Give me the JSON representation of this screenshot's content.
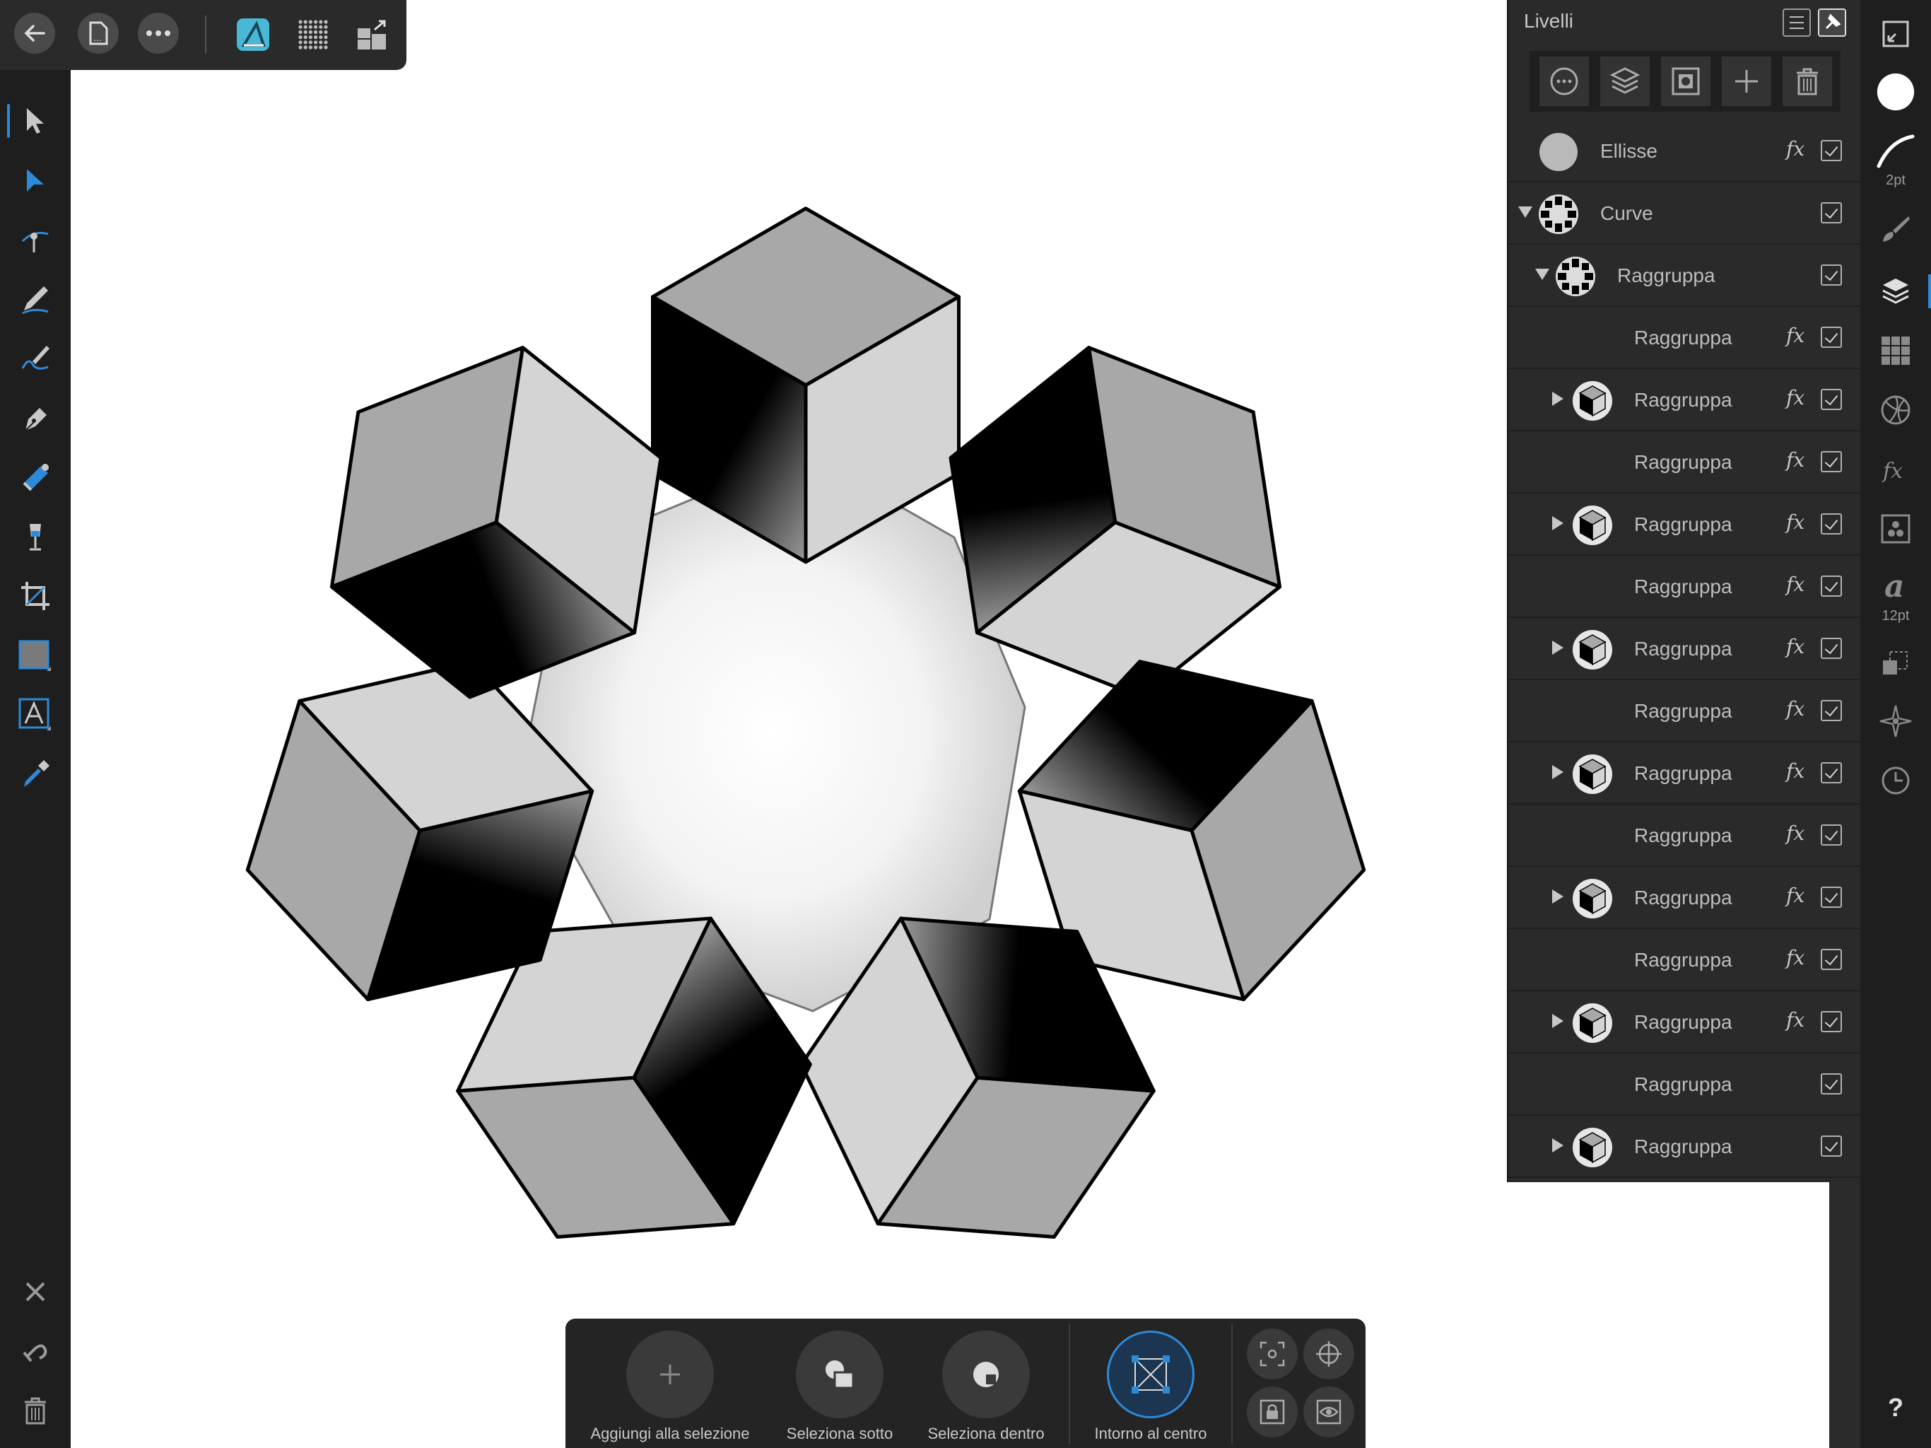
{
  "icons": {
    "back": "arrow-left-icon",
    "document": "document-icon",
    "more": "more-icon",
    "app_logo": "affinity-designer-logo-icon",
    "pixel_persona": "pixel-persona-icon",
    "export_persona": "export-persona-icon"
  },
  "colors": {
    "accent": "#2d8ad8",
    "panel": "#2a2a2a",
    "toolbar": "#1e1e1e",
    "canvas": "#ffffff",
    "logo": "#49b8d6"
  },
  "left_tools": [
    {
      "name": "move-tool-icon"
    },
    {
      "name": "node-tool-icon"
    },
    {
      "name": "corner-tool-icon"
    },
    {
      "name": "pencil-tool-icon"
    },
    {
      "name": "vector-brush-tool-icon"
    },
    {
      "name": "pen-tool-icon"
    },
    {
      "name": "fill-tool-icon"
    },
    {
      "name": "transparency-tool-icon"
    },
    {
      "name": "crop-tool-icon"
    },
    {
      "name": "rectangle-tool-icon"
    },
    {
      "name": "text-tool-icon"
    },
    {
      "name": "color-picker-tool-icon"
    }
  ],
  "left_bottom": [
    "close-icon",
    "undo-icon",
    "trash-icon"
  ],
  "right_strip": {
    "stroke_width": "2pt",
    "font_size": "12pt",
    "help": "?"
  },
  "layers_panel": {
    "title": "Livelli",
    "rows": [
      {
        "name": "Ellisse",
        "fx": "fx",
        "expand": "none",
        "indent": 0
      },
      {
        "name": "Curve",
        "fx": "",
        "expand": "down",
        "indent": 0
      },
      {
        "name": "Raggruppa",
        "fx": "",
        "expand": "down",
        "indent": 1
      },
      {
        "name": "Raggruppa",
        "fx": "fx",
        "expand": "none",
        "indent": 2
      },
      {
        "name": "Raggruppa",
        "fx": "fx",
        "expand": "right",
        "indent": 2
      },
      {
        "name": "Raggruppa",
        "fx": "fx",
        "expand": "none",
        "indent": 2
      },
      {
        "name": "Raggruppa",
        "fx": "fx",
        "expand": "right",
        "indent": 2
      },
      {
        "name": "Raggruppa",
        "fx": "fx",
        "expand": "none",
        "indent": 2
      },
      {
        "name": "Raggruppa",
        "fx": "fx",
        "expand": "right",
        "indent": 2
      },
      {
        "name": "Raggruppa",
        "fx": "fx",
        "expand": "none",
        "indent": 2
      },
      {
        "name": "Raggruppa",
        "fx": "fx",
        "expand": "right",
        "indent": 2
      },
      {
        "name": "Raggruppa",
        "fx": "fx",
        "expand": "none",
        "indent": 2
      },
      {
        "name": "Raggruppa",
        "fx": "fx",
        "expand": "right",
        "indent": 2
      },
      {
        "name": "Raggruppa",
        "fx": "fx",
        "expand": "none",
        "indent": 2
      },
      {
        "name": "Raggruppa",
        "fx": "fx",
        "expand": "right",
        "indent": 2
      },
      {
        "name": "Raggruppa",
        "fx": "",
        "expand": "none",
        "indent": 2
      },
      {
        "name": "Raggruppa",
        "fx": "",
        "expand": "right",
        "indent": 2
      }
    ]
  },
  "context_toolbar": {
    "add_to_selection": "Aggiungi alla selezione",
    "select_under": "Seleziona sotto",
    "select_inside": "Seleziona dentro",
    "around_center": "Intorno al centro"
  }
}
